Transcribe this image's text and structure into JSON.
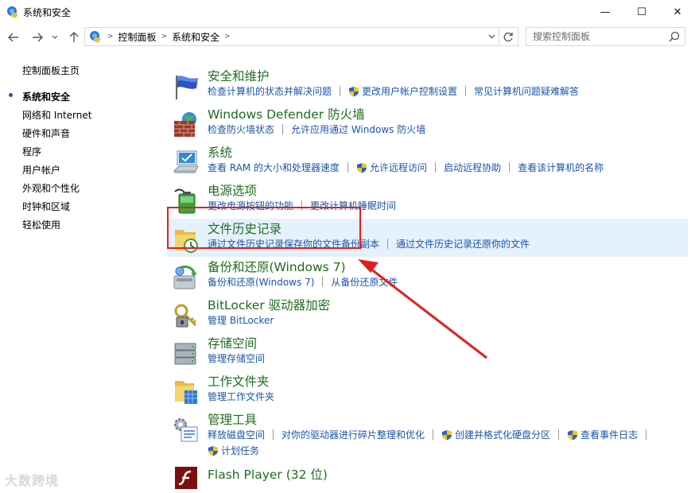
{
  "window": {
    "title": "系统和安全",
    "minimize_glyph": "—",
    "maximize_glyph": "☐",
    "close_glyph": "✕"
  },
  "nav": {
    "breadcrumbs": [
      "控制面板",
      "系统和安全"
    ],
    "search_placeholder": "搜索控制面板"
  },
  "sidebar": {
    "home": "控制面板主页",
    "items": [
      {
        "label": "系统和安全",
        "current": true
      },
      {
        "label": "网络和 Internet"
      },
      {
        "label": "硬件和声音"
      },
      {
        "label": "程序"
      },
      {
        "label": "用户帐户"
      },
      {
        "label": "外观和个性化"
      },
      {
        "label": "时钟和区域"
      },
      {
        "label": "轻松使用"
      }
    ]
  },
  "categories": [
    {
      "title": "安全和维护",
      "icon": "flag-icon",
      "links": [
        {
          "label": "检查计算机的状态并解决问题"
        },
        {
          "label": "更改用户帐户控制设置",
          "shield": true
        },
        {
          "label": "常见计算机问题疑难解答"
        }
      ]
    },
    {
      "title": "Windows Defender 防火墙",
      "icon": "firewall-icon",
      "links": [
        {
          "label": "检查防火墙状态"
        },
        {
          "label": "允许应用通过 Windows 防火墙"
        }
      ]
    },
    {
      "title": "系统",
      "icon": "computer-icon",
      "links": [
        {
          "label": "查看 RAM 的大小和处理器速度"
        },
        {
          "label": "允许远程访问",
          "shield": true
        },
        {
          "label": "启动远程协助"
        },
        {
          "label": "查看该计算机的名称"
        }
      ]
    },
    {
      "title": "电源选项",
      "icon": "battery-icon",
      "links": [
        {
          "label": "更改电源按钮的功能"
        },
        {
          "label": "更改计算机睡眠时间"
        }
      ]
    },
    {
      "title": "文件历史记录",
      "icon": "file-history-icon",
      "links": [
        {
          "label": "通过文件历史记录保存你的文件备份副本"
        },
        {
          "label": "通过文件历史记录还原你的文件"
        }
      ]
    },
    {
      "title": "备份和还原(Windows 7)",
      "icon": "backup-icon",
      "links": [
        {
          "label": "备份和还原(Windows 7)"
        },
        {
          "label": "从备份还原文件"
        }
      ]
    },
    {
      "title": "BitLocker 驱动器加密",
      "icon": "bitlocker-icon",
      "links": [
        {
          "label": "管理 BitLocker"
        }
      ]
    },
    {
      "title": "存储空间",
      "icon": "storage-icon",
      "links": [
        {
          "label": "管理存储空间"
        }
      ]
    },
    {
      "title": "工作文件夹",
      "icon": "work-folders-icon",
      "links": [
        {
          "label": "管理工作文件夹"
        }
      ]
    },
    {
      "title": "管理工具",
      "icon": "admin-tools-icon",
      "links": [
        {
          "label": "释放磁盘空间"
        },
        {
          "label": "对你的驱动器进行碎片整理和优化"
        },
        {
          "label": "创建并格式化硬盘分区",
          "shield": true
        },
        {
          "label": "查看事件日志",
          "shield": true
        }
      ],
      "links2": [
        {
          "label": "计划任务",
          "shield": true
        }
      ]
    },
    {
      "title": "Flash Player (32 位)",
      "icon": "flash-icon",
      "links": []
    }
  ],
  "watermark": "大数跨境",
  "colors": {
    "link": "#1a56a8",
    "category_title": "#1e6e1e",
    "highlight": "#e5f1fb",
    "annotation": "#e02020"
  }
}
